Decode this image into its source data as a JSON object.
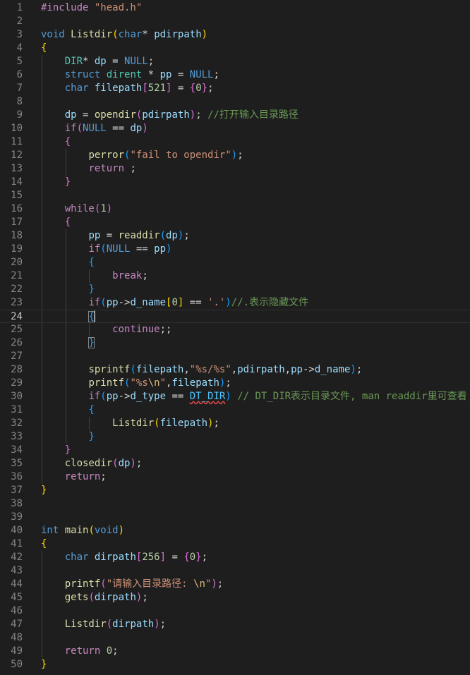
{
  "editor": {
    "language": "c",
    "current_line": 24,
    "colors": {
      "background": "#1e1e1e",
      "line_number": "#858585",
      "line_number_active": "#c6c6c6",
      "preprocessor": "#c586c0",
      "string": "#ce9178",
      "keyword": "#569cd6",
      "function": "#dcdcaa",
      "variable": "#9cdcfe",
      "type": "#4ec9b0",
      "number": "#b5cea8",
      "comment": "#6a9955",
      "macro": "#4fc1ff"
    },
    "lines": [
      {
        "n": "1",
        "t": [
          [
            "pp",
            "#include "
          ],
          [
            "str",
            "\"head.h\""
          ]
        ]
      },
      {
        "n": "2",
        "t": []
      },
      {
        "n": "3",
        "t": [
          [
            "kw",
            "void "
          ],
          [
            "fn",
            "Listdir"
          ],
          [
            "br1",
            "("
          ],
          [
            "kw",
            "char"
          ],
          [
            "pl",
            "* "
          ],
          [
            "var",
            "pdirpath"
          ],
          [
            "br1",
            ")"
          ]
        ]
      },
      {
        "n": "4",
        "t": [
          [
            "br1",
            "{"
          ]
        ]
      },
      {
        "n": "5",
        "t": [
          [
            "pl",
            "    "
          ],
          [
            "type",
            "DIR"
          ],
          [
            "pl",
            "* "
          ],
          [
            "var",
            "dp"
          ],
          [
            "pl",
            " = "
          ],
          [
            "kw",
            "NULL"
          ],
          [
            "pl",
            ";"
          ]
        ]
      },
      {
        "n": "6",
        "t": [
          [
            "pl",
            "    "
          ],
          [
            "kw",
            "struct "
          ],
          [
            "type",
            "dirent"
          ],
          [
            "pl",
            " * "
          ],
          [
            "var",
            "pp"
          ],
          [
            "pl",
            " = "
          ],
          [
            "kw",
            "NULL"
          ],
          [
            "pl",
            ";"
          ]
        ]
      },
      {
        "n": "7",
        "t": [
          [
            "pl",
            "    "
          ],
          [
            "kw",
            "char "
          ],
          [
            "var",
            "filepath"
          ],
          [
            "br2",
            "["
          ],
          [
            "num",
            "521"
          ],
          [
            "br2",
            "]"
          ],
          [
            "pl",
            " = "
          ],
          [
            "br2",
            "{"
          ],
          [
            "num",
            "0"
          ],
          [
            "br2",
            "}"
          ],
          [
            "pl",
            ";"
          ]
        ]
      },
      {
        "n": "8",
        "t": []
      },
      {
        "n": "9",
        "t": [
          [
            "pl",
            "    "
          ],
          [
            "var",
            "dp"
          ],
          [
            "pl",
            " = "
          ],
          [
            "fn",
            "opendir"
          ],
          [
            "br2",
            "("
          ],
          [
            "var",
            "pdirpath"
          ],
          [
            "br2",
            ")"
          ],
          [
            "pl",
            "; "
          ],
          [
            "com",
            "//打开输入目录路径"
          ]
        ]
      },
      {
        "n": "10",
        "t": [
          [
            "pl",
            "    "
          ],
          [
            "ctl",
            "if"
          ],
          [
            "br2",
            "("
          ],
          [
            "kw",
            "NULL"
          ],
          [
            "pl",
            " == "
          ],
          [
            "var",
            "dp"
          ],
          [
            "br2",
            ")"
          ]
        ]
      },
      {
        "n": "11",
        "t": [
          [
            "pl",
            "    "
          ],
          [
            "br2",
            "{"
          ]
        ]
      },
      {
        "n": "12",
        "t": [
          [
            "pl",
            "        "
          ],
          [
            "fn",
            "perror"
          ],
          [
            "br3",
            "("
          ],
          [
            "str",
            "\"fail to opendir\""
          ],
          [
            "br3",
            ")"
          ],
          [
            "pl",
            ";"
          ]
        ]
      },
      {
        "n": "13",
        "t": [
          [
            "pl",
            "        "
          ],
          [
            "ctl",
            "return"
          ],
          [
            "pl",
            " ;"
          ]
        ]
      },
      {
        "n": "14",
        "t": [
          [
            "pl",
            "    "
          ],
          [
            "br2",
            "}"
          ]
        ]
      },
      {
        "n": "15",
        "t": []
      },
      {
        "n": "16",
        "t": [
          [
            "pl",
            "    "
          ],
          [
            "ctl",
            "while"
          ],
          [
            "br2",
            "("
          ],
          [
            "num",
            "1"
          ],
          [
            "br2",
            ")"
          ]
        ]
      },
      {
        "n": "17",
        "t": [
          [
            "pl",
            "    "
          ],
          [
            "br2",
            "{"
          ]
        ]
      },
      {
        "n": "18",
        "t": [
          [
            "pl",
            "        "
          ],
          [
            "var",
            "pp"
          ],
          [
            "pl",
            " = "
          ],
          [
            "fn",
            "readdir"
          ],
          [
            "br3",
            "("
          ],
          [
            "var",
            "dp"
          ],
          [
            "br3",
            ")"
          ],
          [
            "pl",
            ";"
          ]
        ]
      },
      {
        "n": "19",
        "t": [
          [
            "pl",
            "        "
          ],
          [
            "ctl",
            "if"
          ],
          [
            "br3",
            "("
          ],
          [
            "kw",
            "NULL"
          ],
          [
            "pl",
            " == "
          ],
          [
            "var",
            "pp"
          ],
          [
            "br3",
            ")"
          ]
        ]
      },
      {
        "n": "20",
        "t": [
          [
            "pl",
            "        "
          ],
          [
            "br3",
            "{"
          ]
        ]
      },
      {
        "n": "21",
        "t": [
          [
            "pl",
            "            "
          ],
          [
            "ctl",
            "break"
          ],
          [
            "pl",
            ";"
          ]
        ]
      },
      {
        "n": "22",
        "t": [
          [
            "pl",
            "        "
          ],
          [
            "br3",
            "}"
          ]
        ]
      },
      {
        "n": "23",
        "t": [
          [
            "pl",
            "        "
          ],
          [
            "ctl",
            "if"
          ],
          [
            "br3",
            "("
          ],
          [
            "var",
            "pp"
          ],
          [
            "pl",
            "->"
          ],
          [
            "var",
            "d_name"
          ],
          [
            "br1",
            "["
          ],
          [
            "num",
            "0"
          ],
          [
            "br1",
            "]"
          ],
          [
            "pl",
            " == "
          ],
          [
            "str",
            "'.'"
          ],
          [
            "br3",
            ")"
          ],
          [
            "com",
            "//.表示隐藏文件"
          ]
        ]
      },
      {
        "n": "24",
        "t": [
          [
            "pl",
            "        "
          ],
          [
            "br3m",
            "{"
          ]
        ]
      },
      {
        "n": "25",
        "t": [
          [
            "pl",
            "            "
          ],
          [
            "ctl",
            "continue"
          ],
          [
            "pl",
            ";;"
          ]
        ]
      },
      {
        "n": "26",
        "t": [
          [
            "pl",
            "        "
          ],
          [
            "br3m",
            "}"
          ]
        ]
      },
      {
        "n": "27",
        "t": []
      },
      {
        "n": "28",
        "t": [
          [
            "pl",
            "        "
          ],
          [
            "fn",
            "sprintf"
          ],
          [
            "br3",
            "("
          ],
          [
            "var",
            "filepath"
          ],
          [
            "pl",
            ","
          ],
          [
            "str",
            "\"%s/%s\""
          ],
          [
            "pl",
            ","
          ],
          [
            "var",
            "pdirpath"
          ],
          [
            "pl",
            ","
          ],
          [
            "var",
            "pp"
          ],
          [
            "pl",
            "->"
          ],
          [
            "var",
            "d_name"
          ],
          [
            "br3",
            ")"
          ],
          [
            "pl",
            ";"
          ]
        ]
      },
      {
        "n": "29",
        "t": [
          [
            "pl",
            "        "
          ],
          [
            "fn",
            "printf"
          ],
          [
            "br3",
            "("
          ],
          [
            "str",
            "\"%s"
          ],
          [
            "esc",
            "\\n"
          ],
          [
            "str",
            "\""
          ],
          [
            "pl",
            ","
          ],
          [
            "var",
            "filepath"
          ],
          [
            "br3",
            ")"
          ],
          [
            "pl",
            ";"
          ]
        ]
      },
      {
        "n": "30",
        "t": [
          [
            "pl",
            "        "
          ],
          [
            "ctl",
            "if"
          ],
          [
            "br3",
            "("
          ],
          [
            "var",
            "pp"
          ],
          [
            "pl",
            "->"
          ],
          [
            "var",
            "d_type"
          ],
          [
            "pl",
            " == "
          ],
          [
            "macsq",
            "DT_DIR"
          ],
          [
            "br3",
            ")"
          ],
          [
            "pl",
            " "
          ],
          [
            "com",
            "// DT_DIR表示目录文件, man readdir里可查看"
          ]
        ]
      },
      {
        "n": "31",
        "t": [
          [
            "pl",
            "        "
          ],
          [
            "br3",
            "{"
          ]
        ]
      },
      {
        "n": "32",
        "t": [
          [
            "pl",
            "            "
          ],
          [
            "fn",
            "Listdir"
          ],
          [
            "br1",
            "("
          ],
          [
            "var",
            "filepath"
          ],
          [
            "br1",
            ")"
          ],
          [
            "pl",
            ";"
          ]
        ]
      },
      {
        "n": "33",
        "t": [
          [
            "pl",
            "        "
          ],
          [
            "br3",
            "}"
          ]
        ]
      },
      {
        "n": "34",
        "t": [
          [
            "pl",
            "    "
          ],
          [
            "br2",
            "}"
          ]
        ]
      },
      {
        "n": "35",
        "t": [
          [
            "pl",
            "    "
          ],
          [
            "fn",
            "closedir"
          ],
          [
            "br2",
            "("
          ],
          [
            "var",
            "dp"
          ],
          [
            "br2",
            ")"
          ],
          [
            "pl",
            ";"
          ]
        ]
      },
      {
        "n": "36",
        "t": [
          [
            "pl",
            "    "
          ],
          [
            "ctl",
            "return"
          ],
          [
            "pl",
            ";"
          ]
        ]
      },
      {
        "n": "37",
        "t": [
          [
            "br1",
            "}"
          ]
        ]
      },
      {
        "n": "38",
        "t": []
      },
      {
        "n": "39",
        "t": []
      },
      {
        "n": "40",
        "t": [
          [
            "kw",
            "int "
          ],
          [
            "fn",
            "main"
          ],
          [
            "br1",
            "("
          ],
          [
            "kw",
            "void"
          ],
          [
            "br1",
            ")"
          ]
        ]
      },
      {
        "n": "41",
        "t": [
          [
            "br1",
            "{"
          ]
        ]
      },
      {
        "n": "42",
        "t": [
          [
            "pl",
            "    "
          ],
          [
            "kw",
            "char "
          ],
          [
            "var",
            "dirpath"
          ],
          [
            "br2",
            "["
          ],
          [
            "num",
            "256"
          ],
          [
            "br2",
            "]"
          ],
          [
            "pl",
            " = "
          ],
          [
            "br2",
            "{"
          ],
          [
            "num",
            "0"
          ],
          [
            "br2",
            "}"
          ],
          [
            "pl",
            ";"
          ]
        ]
      },
      {
        "n": "43",
        "t": []
      },
      {
        "n": "44",
        "t": [
          [
            "pl",
            "    "
          ],
          [
            "fn",
            "printf"
          ],
          [
            "br2",
            "("
          ],
          [
            "str",
            "\"请输入目录路径: "
          ],
          [
            "esc",
            "\\n"
          ],
          [
            "str",
            "\""
          ],
          [
            "br2",
            ")"
          ],
          [
            "pl",
            ";"
          ]
        ]
      },
      {
        "n": "45",
        "t": [
          [
            "pl",
            "    "
          ],
          [
            "fn",
            "gets"
          ],
          [
            "br2",
            "("
          ],
          [
            "var",
            "dirpath"
          ],
          [
            "br2",
            ")"
          ],
          [
            "pl",
            ";"
          ]
        ]
      },
      {
        "n": "46",
        "t": []
      },
      {
        "n": "47",
        "t": [
          [
            "pl",
            "    "
          ],
          [
            "fn",
            "Listdir"
          ],
          [
            "br2",
            "("
          ],
          [
            "var",
            "dirpath"
          ],
          [
            "br2",
            ")"
          ],
          [
            "pl",
            ";"
          ]
        ]
      },
      {
        "n": "48",
        "t": []
      },
      {
        "n": "49",
        "t": [
          [
            "pl",
            "    "
          ],
          [
            "ctl",
            "return "
          ],
          [
            "num",
            "0"
          ],
          [
            "pl",
            ";"
          ]
        ]
      },
      {
        "n": "50",
        "t": [
          [
            "br1",
            "}"
          ]
        ]
      }
    ]
  }
}
